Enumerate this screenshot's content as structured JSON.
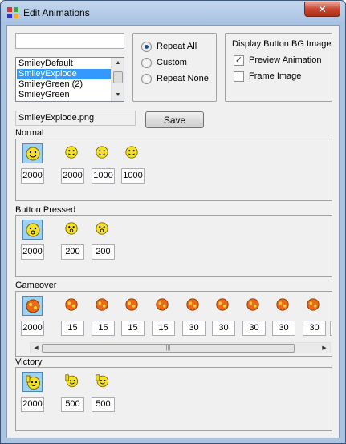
{
  "window": {
    "title": "Edit Animations",
    "close_label": "✕"
  },
  "top": {
    "name_value": "",
    "list": {
      "items": [
        "SmileyDefault",
        "SmileyExplode",
        "SmileyGreen (2)",
        "SmileyGreen"
      ],
      "selected": 1
    },
    "file_name": "SmileyExplode.png",
    "save_label": "Save"
  },
  "repeat": {
    "options": [
      {
        "label": "Repeat All",
        "checked": true
      },
      {
        "label": "Custom",
        "checked": false
      },
      {
        "label": "Repeat None",
        "checked": false
      }
    ]
  },
  "display": {
    "title": "Display Button BG Image",
    "preview": {
      "label": "Preview Animation",
      "checked": true
    },
    "frame": {
      "label": "Frame Image",
      "checked": false
    }
  },
  "sections": [
    {
      "title": "Normal",
      "icon": "smiley-face-icon",
      "values": [
        "2000",
        "2000",
        "1000",
        "1000"
      ]
    },
    {
      "title": "Button Pressed",
      "icon": "smiley-pressed-icon",
      "values": [
        "2000",
        "200",
        "200"
      ]
    },
    {
      "title": "Gameover",
      "icon": "smiley-explode-icon",
      "values": [
        "2000",
        "15",
        "15",
        "15",
        "15",
        "30",
        "30",
        "30",
        "30",
        "30",
        "3"
      ]
    },
    {
      "title": "Victory",
      "icon": "smiley-victory-icon",
      "values": [
        "2000",
        "500",
        "500"
      ]
    }
  ],
  "colors": {
    "accent": "#3399ff",
    "smiley": "#f5e12a",
    "explode": "#e86a1a"
  }
}
